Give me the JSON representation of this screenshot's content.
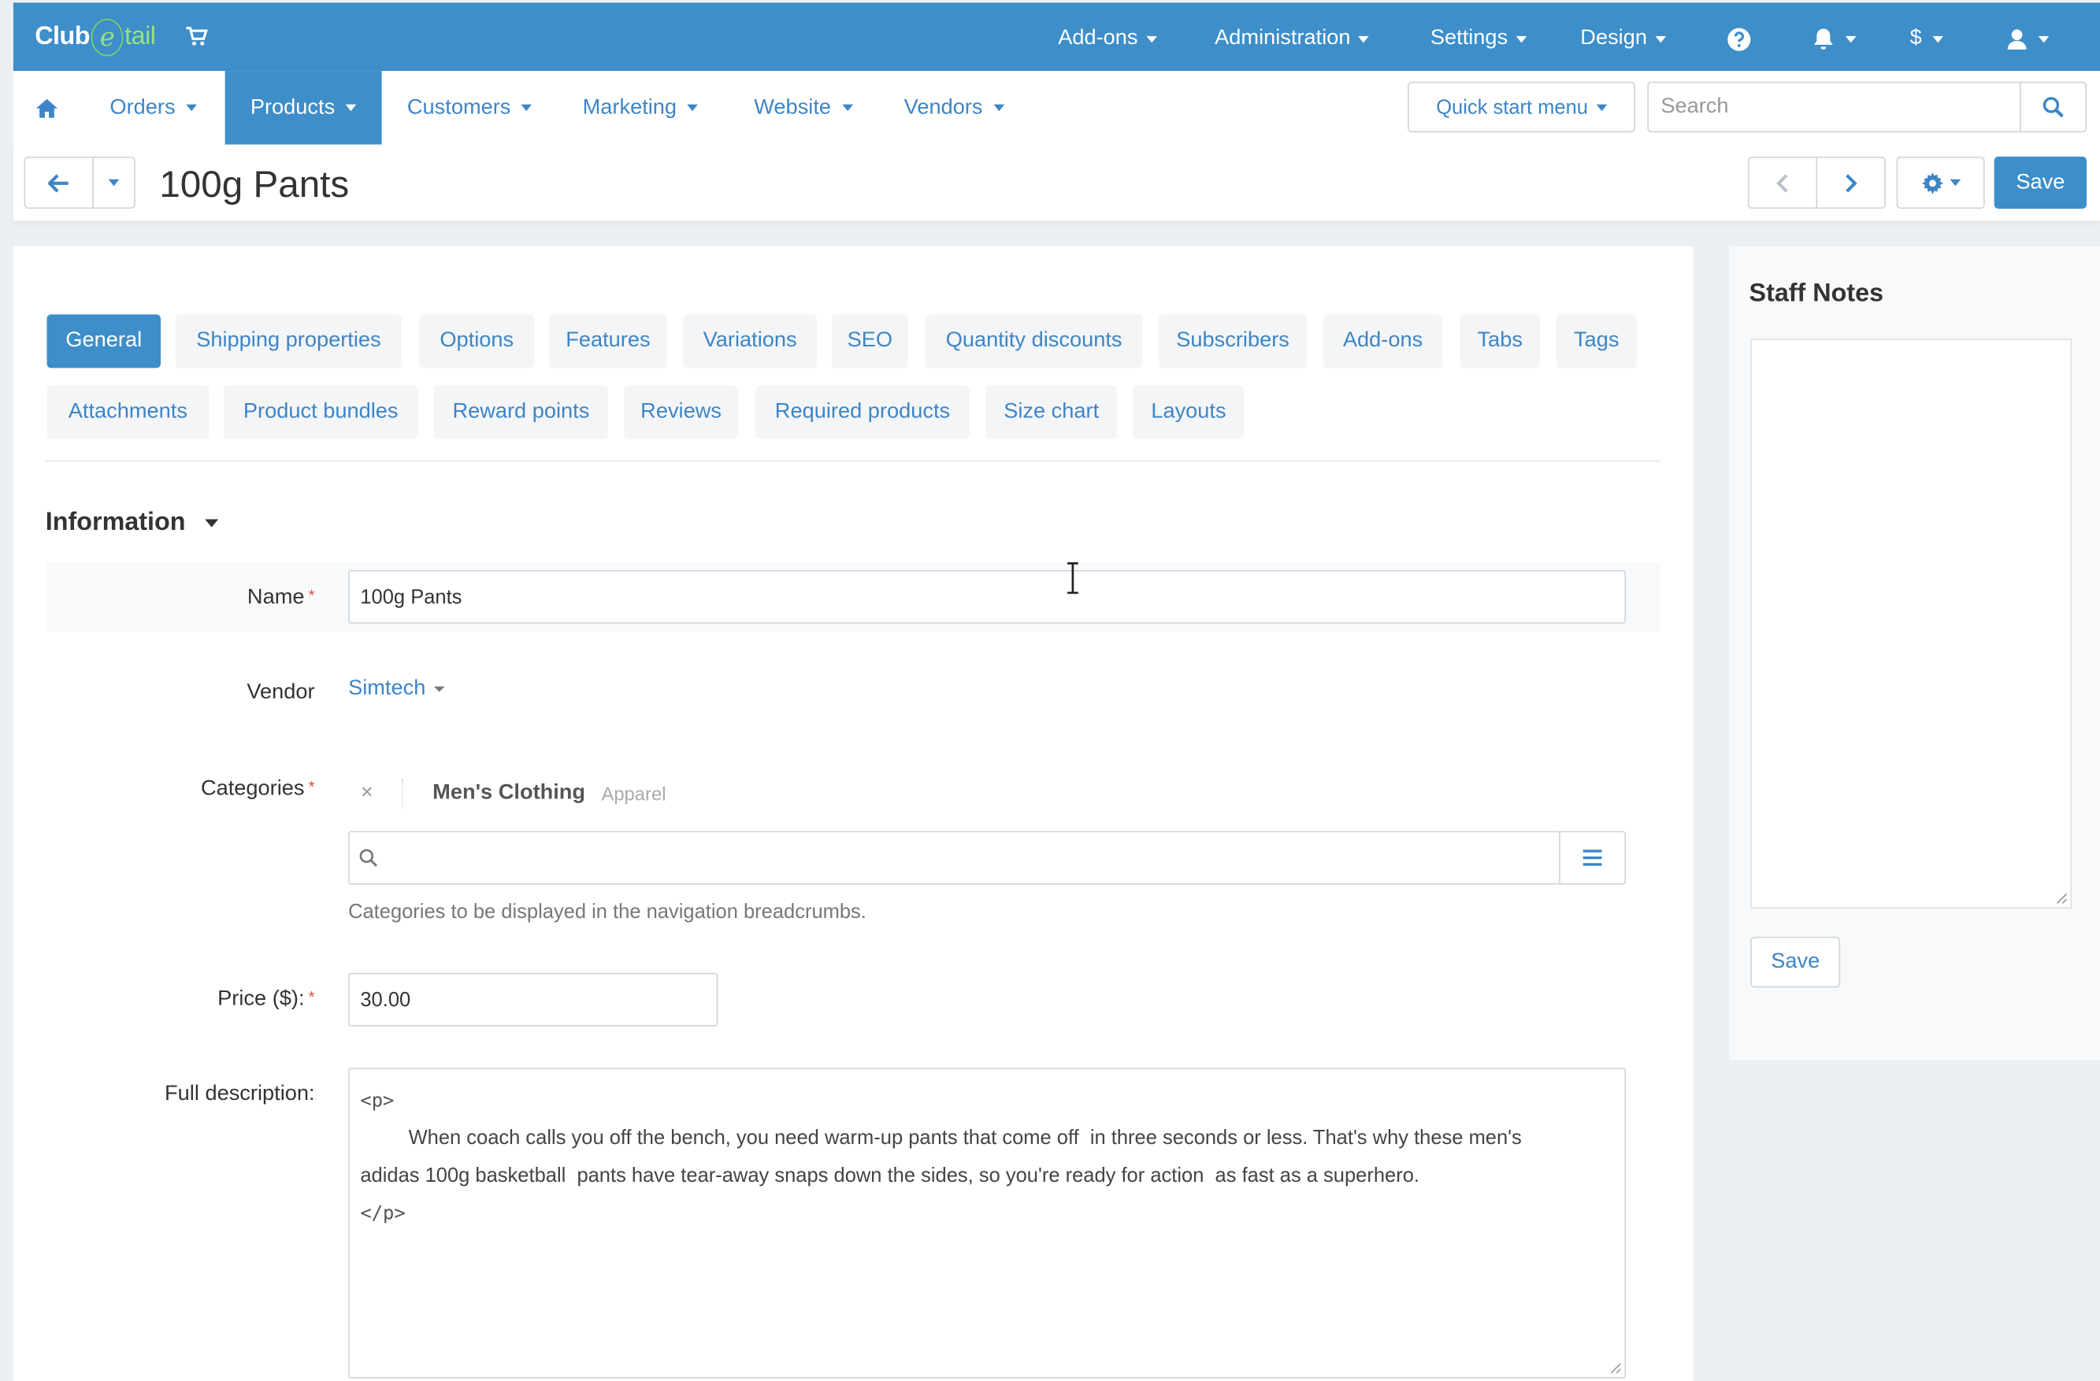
{
  "brand": {
    "logo_prefix": "Club",
    "logo_e": "e",
    "logo_suffix": "tail",
    "topbar_color": "#3d8ec9",
    "accent_green": "#9be07f"
  },
  "top_menu": {
    "items": [
      {
        "label": "Add-ons"
      },
      {
        "label": "Administration"
      },
      {
        "label": "Settings"
      },
      {
        "label": "Design"
      }
    ],
    "currency_label": "$",
    "icons": [
      "help-icon",
      "bell-icon",
      "user-icon",
      "cart-icon"
    ]
  },
  "main_menu": {
    "items": [
      {
        "label": "Orders"
      },
      {
        "label": "Products"
      },
      {
        "label": "Customers"
      },
      {
        "label": "Marketing"
      },
      {
        "label": "Website"
      },
      {
        "label": "Vendors"
      }
    ],
    "active": "Products",
    "quick_start_label": "Quick start menu",
    "search_placeholder": "Search"
  },
  "header": {
    "title": "100g Pants",
    "save_label": "Save"
  },
  "tabs": {
    "row1": [
      "General",
      "Shipping properties",
      "Options",
      "Features",
      "Variations",
      "SEO",
      "Quantity discounts",
      "Subscribers",
      "Add-ons",
      "Tabs",
      "Tags"
    ],
    "row2": [
      "Attachments",
      "Product bundles",
      "Reward points",
      "Reviews",
      "Required products",
      "Size chart",
      "Layouts"
    ],
    "active": "General"
  },
  "information": {
    "section_title": "Information",
    "name_label": "Name",
    "name_value": "100g Pants",
    "vendor_label": "Vendor",
    "vendor_value": "Simtech",
    "categories_label": "Categories",
    "category_name": "Men's Clothing",
    "category_parent": "Apparel",
    "category_remove": "×",
    "categories_hint": "Categories to be displayed in the navigation breadcrumbs.",
    "price_label": "Price ($):",
    "price_value": "30.00",
    "description_label": "Full description:",
    "description_lines": [
      "<p>",
      "When coach calls you off the bench, you need warm-up pants that come off  in three seconds or less. That's why these men's",
      "adidas 100g basketball  pants have tear-away snaps down the sides, so you're ready for action  as fast as a superhero.",
      "</p>"
    ],
    "required_mark": "*"
  },
  "staff_notes": {
    "title": "Staff Notes",
    "save_label": "Save"
  }
}
